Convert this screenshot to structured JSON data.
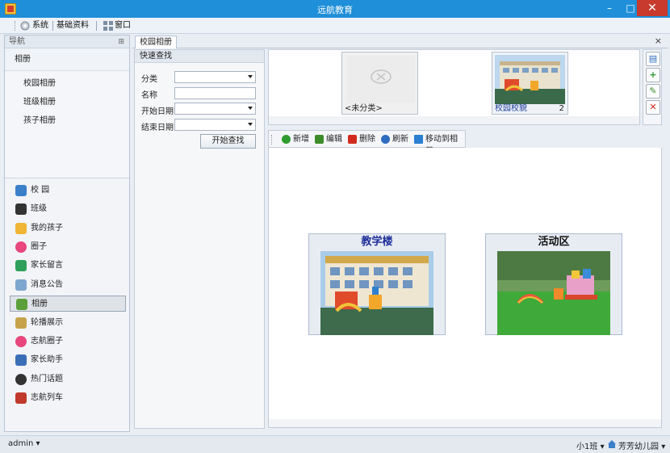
{
  "window": {
    "title": "远航教育"
  },
  "menubar": {
    "items": [
      "系统",
      "基础资料",
      "窗口"
    ]
  },
  "nav": {
    "header": "导航",
    "group_title": "相册",
    "sub_items": [
      "校园相册",
      "班级相册",
      "孩子相册"
    ],
    "modules": [
      "校 园",
      "班级",
      "我的孩子",
      "圈子",
      "家长留言",
      "消息公告",
      "相册",
      "轮播展示",
      "志航圈子",
      "家长助手",
      "热门话题",
      "志航列车"
    ],
    "active_module": "相册"
  },
  "tabs": [
    {
      "label": "校园相册",
      "active": true
    }
  ],
  "search": {
    "header": "快速查找",
    "fields": [
      {
        "label": "分类",
        "type": "select",
        "value": ""
      },
      {
        "label": "名称",
        "type": "text",
        "value": ""
      },
      {
        "label": "开始日期",
        "type": "select",
        "value": ""
      },
      {
        "label": "结束日期",
        "type": "select",
        "value": ""
      }
    ],
    "button": "开始查找"
  },
  "albums": [
    {
      "name": "<未分类>",
      "count": "",
      "has_image": false
    },
    {
      "name": "校园校貌",
      "count": "2",
      "has_image": true
    }
  ],
  "toolbar": {
    "items": [
      {
        "label": "新增",
        "icon": "plus-circle-icon",
        "color": "#2e9b2e"
      },
      {
        "label": "编辑",
        "icon": "pencil-icon",
        "color": "#3d8c2a"
      },
      {
        "label": "删除",
        "icon": "red-x-icon",
        "color": "#d22a1e"
      },
      {
        "label": "刷新",
        "icon": "refresh-icon",
        "color": "#2d6cc0"
      },
      {
        "label": "移动到相册",
        "icon": "move-arrows-icon",
        "color": "#2a7fd0"
      }
    ]
  },
  "side_tools": [
    "album-icon",
    "add-icon",
    "edit-icon",
    "delete-icon"
  ],
  "photos": [
    {
      "title": "教学楼"
    },
    {
      "title": "活动区"
    }
  ],
  "status": {
    "user": "admin",
    "class": "小1班",
    "school": "芳芳幼儿园"
  },
  "colors": {
    "titlebar": "#1e8fd8",
    "close": "#c73a2d",
    "link": "#1a3a9a"
  }
}
